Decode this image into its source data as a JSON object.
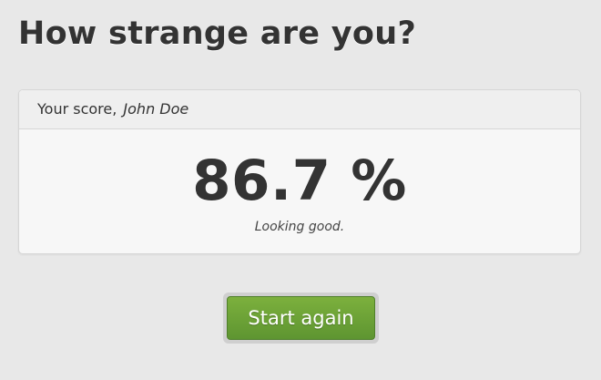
{
  "page": {
    "title": "How strange are you?"
  },
  "score_panel": {
    "header_label": "Your score,",
    "user_name": "John Doe",
    "score": "86.7 %",
    "comment": "Looking good."
  },
  "actions": {
    "start_again_label": "Start again"
  },
  "colors": {
    "background": "#e8e8e8",
    "button_accent": "#6aa136",
    "text": "#333333"
  }
}
